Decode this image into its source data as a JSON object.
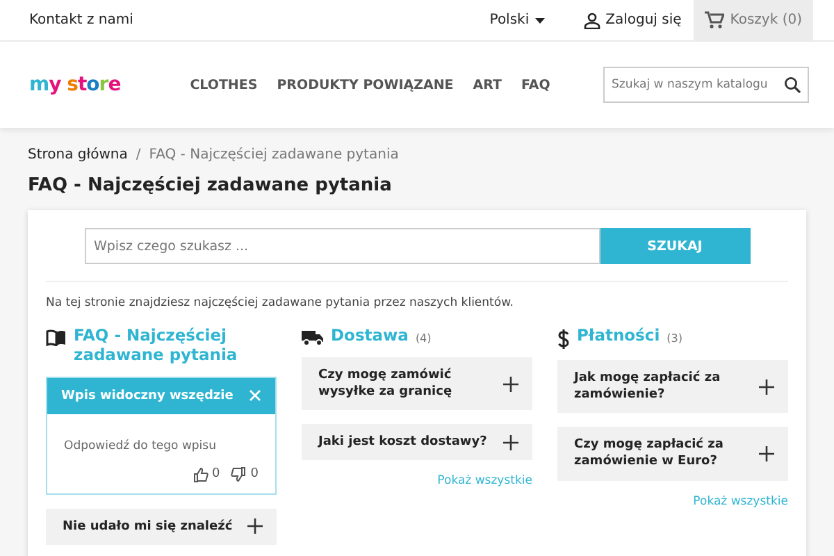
{
  "top_bar": {
    "contact": "Kontakt z nami",
    "language": "Polski",
    "login": "Zaloguj się",
    "cart": "Koszyk (0)"
  },
  "header": {
    "logo": "my store",
    "nav": [
      "CLOTHES",
      "PRODUKTY POWIĄZANE",
      "ART",
      "FAQ"
    ],
    "search": {
      "placeholder": "Szukaj w naszym katalogu"
    }
  },
  "breadcrumb_separator": "/",
  "breadcrumb": [
    {
      "label": "Strona główna",
      "current": false
    },
    {
      "label": "FAQ - Najczęściej zadawane pytania",
      "current": true
    }
  ],
  "title": "FAQ - Najczęściej zadawane pytania",
  "faq_search": {
    "placeholder": "Wpisz czego szukasz ...",
    "button": "SZUKAJ"
  },
  "intro": "Na tej stronie znajdziesz najczęściej zadawane pytania przez naszych klientów.",
  "categories": [
    {
      "kind": "book",
      "title": "FAQ - Najczęściej zadawane pytania",
      "items": [
        {
          "question": "Wpis widoczny wszędzie",
          "expanded": true,
          "answer": "Odpowiedź do tego wpisu",
          "likes": "0",
          "dislikes": "0"
        },
        {
          "question": "Nie udało mi się znaleźć",
          "expanded": false
        }
      ]
    },
    {
      "kind": "truck",
      "title": "Dostawa",
      "count": "(4)",
      "items": [
        {
          "question": "Czy mogę zamówić wysyłke za granicę",
          "expanded": false
        },
        {
          "question": "Jaki jest koszt dostawy?",
          "expanded": false
        }
      ],
      "show_all": "Pokaż wszystkie"
    },
    {
      "kind": "dollar",
      "title": "Płatności",
      "count": "(3)",
      "items": [
        {
          "question": "Jak mogę zapłacić za zamówienie?",
          "expanded": false
        },
        {
          "question": "Czy mogę zapłacić za zamówienie w Euro?",
          "expanded": false
        }
      ],
      "show_all": "Pokaż wszystkie"
    }
  ]
}
